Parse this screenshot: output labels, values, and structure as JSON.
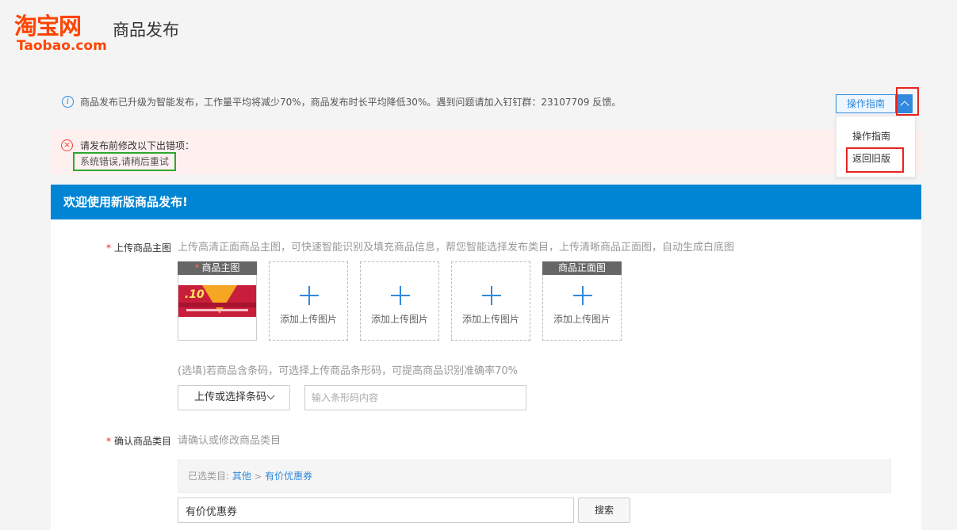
{
  "header": {
    "logo_cn": "淘宝网",
    "logo_en": "Taobao.com",
    "page_title": "商品发布"
  },
  "notice": {
    "text": "商品发布已升级为智能发布，工作量平均将减少70%，商品发布时长平均降低30%。遇到问题请加入钉钉群：23107709 反馈。"
  },
  "guide": {
    "button_label": "操作指南",
    "menu": [
      "操作指南",
      "返回旧版"
    ]
  },
  "error": {
    "title": "请发布前修改以下出错项：",
    "detail": "系统错误,请稍后重试"
  },
  "panel": {
    "header": "欢迎使用新版商品发布!"
  },
  "main_image": {
    "required_mark": "*",
    "label": "上传商品主图",
    "hint": "上传高清正面商品主图，可快速智能识别及填充商品信息，帮您智能选择发布类目，上传清晰商品正面图，自动生成白底图",
    "slots": [
      {
        "title": "商品主图",
        "required": "*",
        "product_number": ".10"
      },
      {
        "add_text": "添加上传图片"
      },
      {
        "add_text": "添加上传图片"
      },
      {
        "add_text": "添加上传图片"
      },
      {
        "title": "商品正面图",
        "add_text": "添加上传图片"
      }
    ]
  },
  "barcode": {
    "hint": "(选填)若商品含条码，可选择上传商品条形码，可提高商品识别准确率70%",
    "select_label": "上传或选择条码",
    "input_placeholder": "输入条形码内容"
  },
  "category": {
    "required_mark": "*",
    "label": "确认商品类目",
    "hint": "请确认或修改商品类目",
    "path_prefix": "已选类目:",
    "path": [
      "其他",
      "有价优惠券"
    ],
    "path_separator": ">",
    "input_value": "有价优惠券",
    "search_label": "搜索"
  },
  "colors": {
    "brand": "#ff4400",
    "primary": "#0085d4",
    "error": "#f04134",
    "highlight_red": "#e8251f",
    "highlight_green": "#2fa82f"
  },
  "icons": {
    "notice": "info-icon",
    "error": "error-circle-icon",
    "toggle": "chevron-up-icon",
    "select": "chevron-down-icon",
    "upload": "plus-icon"
  }
}
